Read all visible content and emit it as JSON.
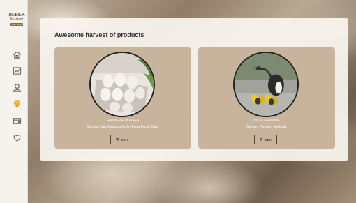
{
  "brand": {
    "line1": "BEBEK",
    "line2": "Mariani",
    "tag": "EST. 2018"
  },
  "sidebar": {
    "items": [
      {
        "name": "home",
        "icon": "home-icon"
      },
      {
        "name": "dashboard",
        "icon": "chart-icon"
      },
      {
        "name": "profile",
        "icon": "user-icon"
      },
      {
        "name": "products",
        "icon": "diamond-icon",
        "active": true
      },
      {
        "name": "wallet",
        "icon": "card-icon"
      },
      {
        "name": "favorites",
        "icon": "heart-icon"
      }
    ]
  },
  "main": {
    "title": "Awesome harvest of products",
    "cards": [
      {
        "name": "FARMFRESH EGGS",
        "description": "Storage dan Cleaning Order Farm Fresh Eggs",
        "button": "BELI",
        "image": "eggs-tray-image"
      },
      {
        "name": "DUCK FARMING",
        "description": "Modern Farming Methods",
        "button": "BELI",
        "image": "duck-and-ducklings-image"
      }
    ]
  },
  "colors": {
    "sidebar_bg": "#f6f3ef",
    "card_bg": "#c8b49c",
    "accent_active": "#d4a020",
    "icon": "#555555"
  }
}
